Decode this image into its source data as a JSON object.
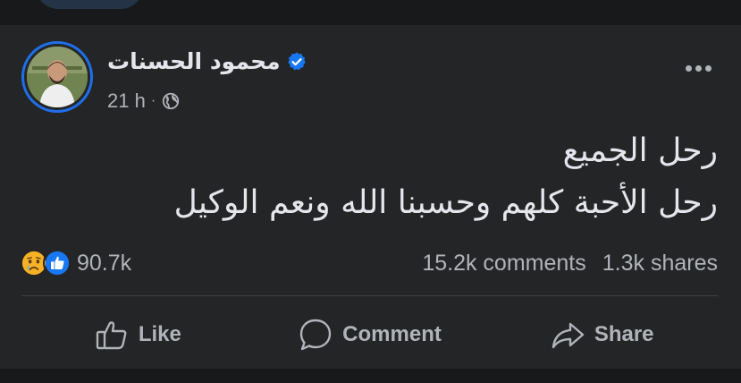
{
  "post": {
    "author": "محمود الحسنات",
    "verified": true,
    "time": "21 h",
    "separator": "·",
    "privacy_icon": "globe-icon",
    "text_lines": [
      "رحل الجميع",
      "رحل الأحبة كلهم وحسبنا الله ونعم الوكيل"
    ]
  },
  "stats": {
    "reaction_icons": [
      "sad-reaction-icon",
      "like-reaction-icon"
    ],
    "reaction_count": "90.7k",
    "comments": "15.2k comments",
    "shares": "1.3k shares"
  },
  "actions": {
    "like": "Like",
    "comment": "Comment",
    "share": "Share"
  },
  "colors": {
    "background": "#18191a",
    "card": "#242526",
    "primary_text": "#e4e6eb",
    "secondary_text": "#b0b3b8",
    "accent": "#1877f2",
    "divider": "#3e4042"
  }
}
